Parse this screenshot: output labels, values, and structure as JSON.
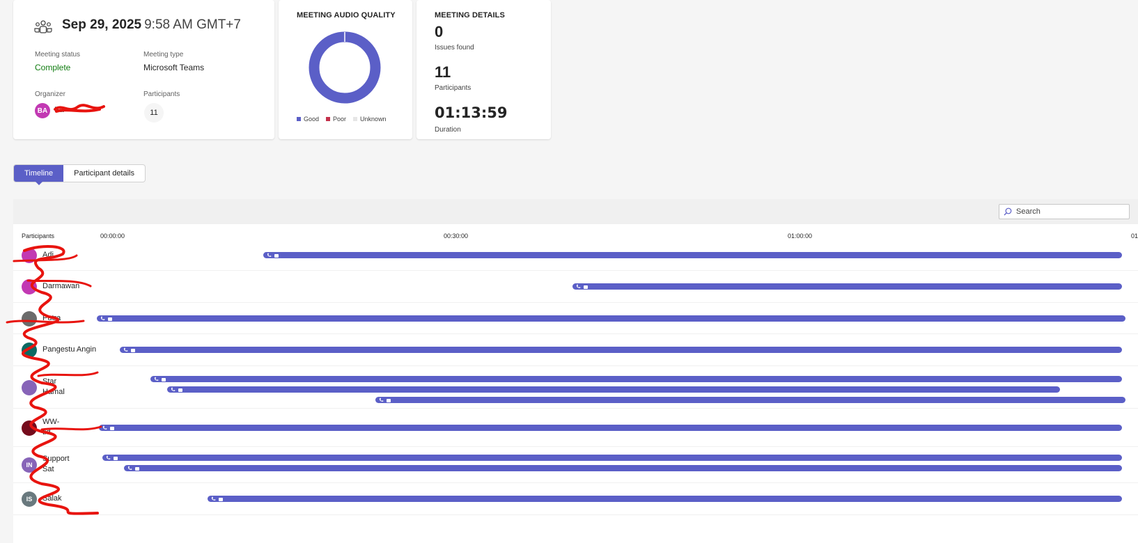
{
  "summary": {
    "date": "Sep 29, 2025",
    "time": "9:58 AM GMT+7",
    "meeting_status_label": "Meeting status",
    "meeting_status": "Complete",
    "meeting_type_label": "Meeting type",
    "meeting_type": "Microsoft Teams",
    "organizer_label": "Organizer",
    "organizer_initials": "BA",
    "organizer_name": "Ba",
    "participants_label": "Participants",
    "participants_count": "11"
  },
  "audio_quality": {
    "title": "MEETING AUDIO QUALITY",
    "legend": [
      {
        "label": "Good",
        "color": "#5b5fc7"
      },
      {
        "label": "Poor",
        "color": "#c4314b"
      },
      {
        "label": "Unknown",
        "color": "#e6e6e6"
      }
    ],
    "good_fraction": 1.0
  },
  "details": {
    "title": "MEETING DETAILS",
    "issues_value": "0",
    "issues_label": "Issues found",
    "participants_value": "11",
    "participants_label": "Participants",
    "duration_value": "01:13:59",
    "duration_label": "Duration"
  },
  "tabs": [
    "Timeline",
    "Participant details"
  ],
  "search": {
    "placeholder": "Search"
  },
  "timeline": {
    "participants_header": "Participants",
    "ticks": [
      "00:00:00",
      "00:30:00",
      "01:00:00",
      "01"
    ],
    "bar_color": "#5b5fc7",
    "rows": [
      {
        "initials": "",
        "avatar_color": "#c239b3",
        "name_lines": [
          "Adi"
        ],
        "sessions": [
          [
            15.2,
            91.2
          ]
        ]
      },
      {
        "initials": "",
        "avatar_color": "#c239b3",
        "name_lines": [
          "Darmawan"
        ],
        "sessions": [
          [
            43.5,
            91.2
          ]
        ]
      },
      {
        "initials": "",
        "avatar_color": "#6b6b6b",
        "name_lines": [
          "Putra"
        ],
        "sessions": [
          [
            0.0,
            91.5
          ]
        ]
      },
      {
        "initials": "",
        "avatar_color": "#0b6a63",
        "name_lines": [
          "Pangestu Angin"
        ],
        "sessions": [
          [
            2.1,
            91.2
          ]
        ]
      },
      {
        "initials": "",
        "avatar_color": "#8764b8",
        "name_lines": [
          "Star",
          "Hamal"
        ],
        "sessions": [
          [
            4.9,
            91.2
          ],
          [
            6.4,
            85.5
          ],
          [
            25.5,
            91.5
          ]
        ]
      },
      {
        "initials": "",
        "avatar_color": "#750b1c",
        "name_lines": [
          "WW-",
          "tid"
        ],
        "sessions": [
          [
            0.2,
            91.2
          ]
        ]
      },
      {
        "initials": "IN",
        "avatar_color": "#8764b8",
        "name_lines": [
          "Support",
          "Sat"
        ],
        "sessions": [
          [
            0.5,
            91.2
          ],
          [
            2.5,
            91.2
          ]
        ]
      },
      {
        "initials": "IS",
        "avatar_color": "#69797e",
        "name_lines": [
          "Salak"
        ],
        "sessions": [
          [
            10.1,
            91.2
          ]
        ]
      }
    ]
  }
}
